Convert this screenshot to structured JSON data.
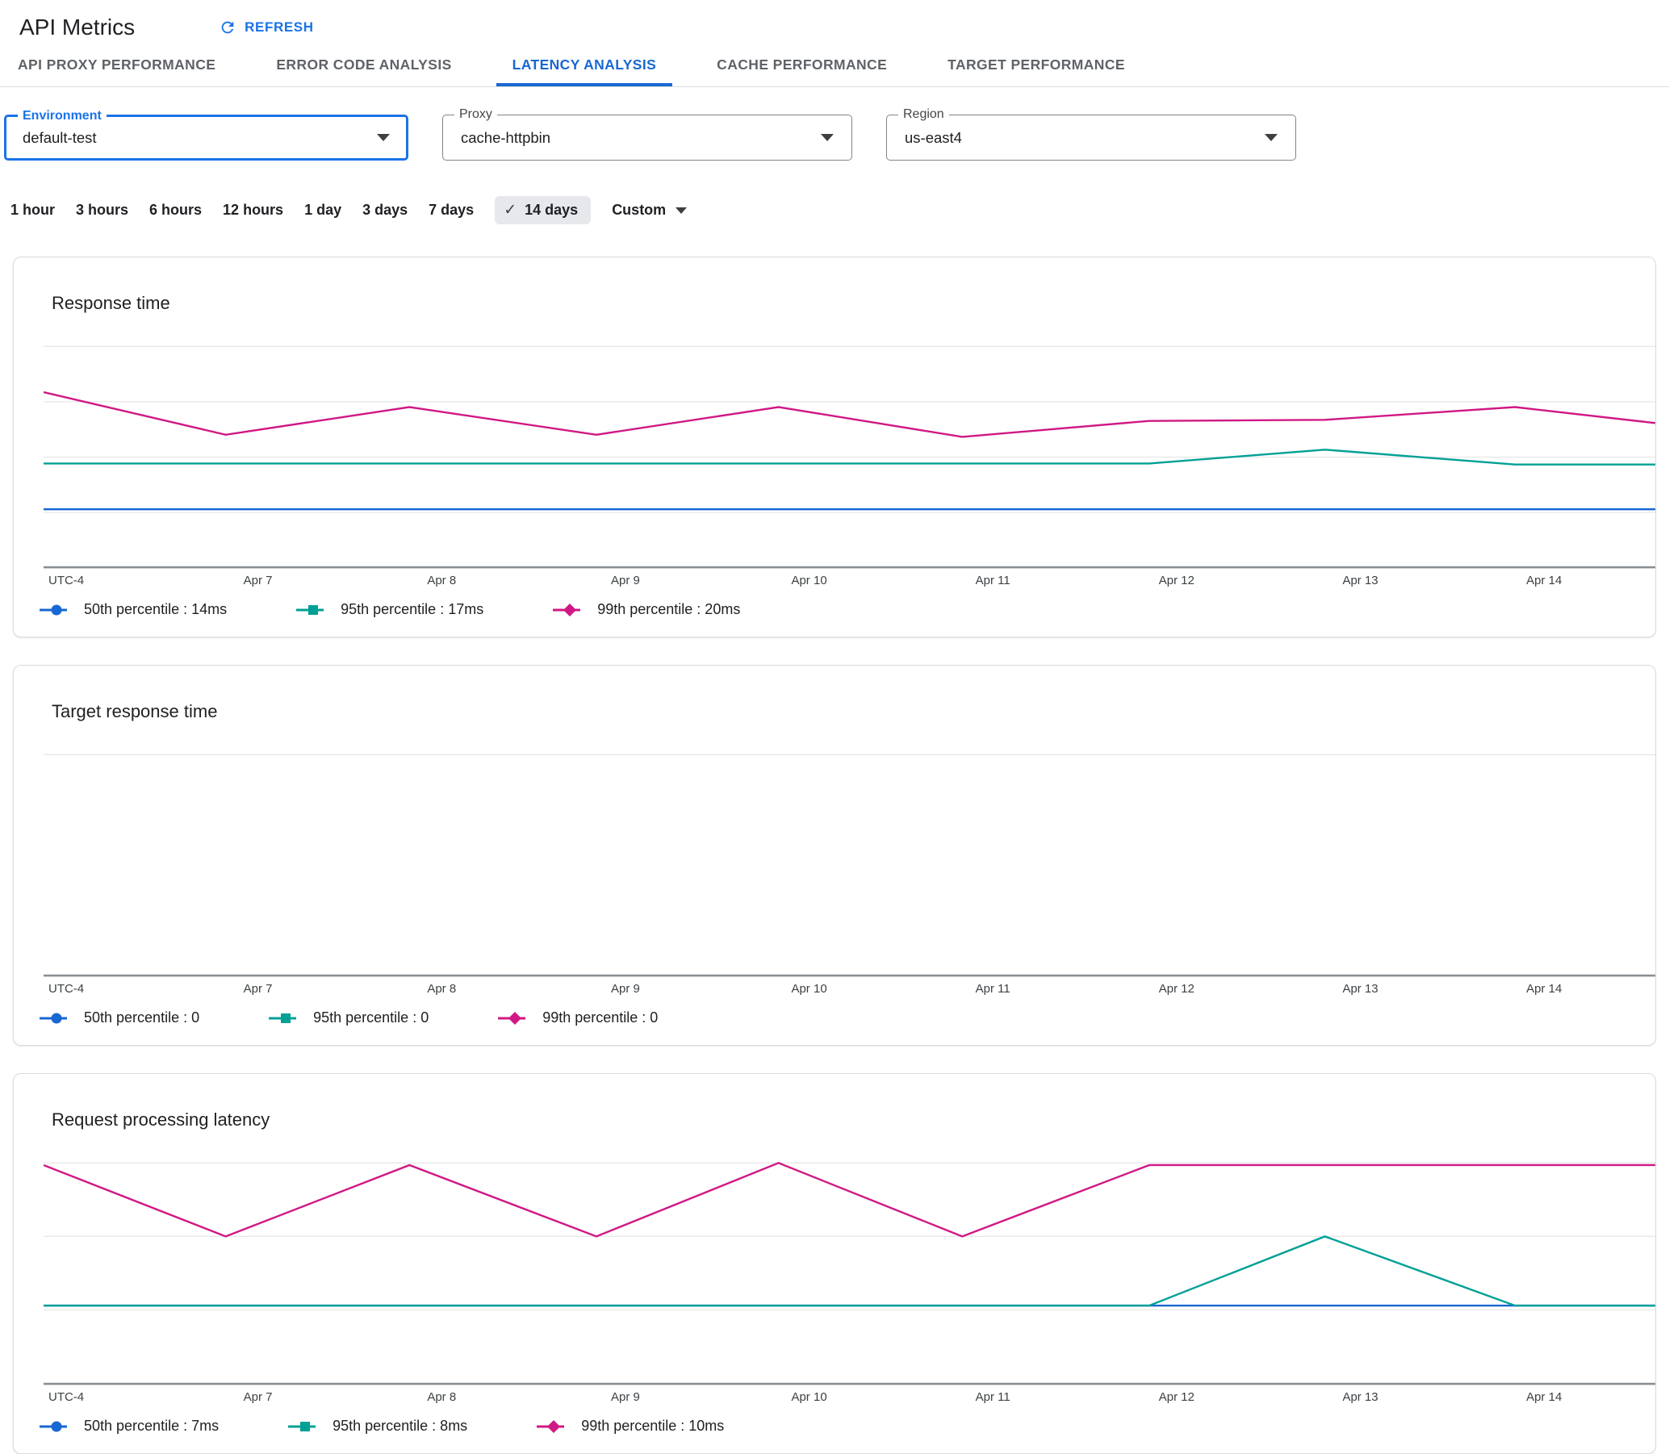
{
  "page": {
    "title": "API Metrics",
    "refresh_label": "REFRESH"
  },
  "icons": {
    "check": "✓"
  },
  "tabs": [
    {
      "label": "API PROXY PERFORMANCE",
      "active": false
    },
    {
      "label": "ERROR CODE ANALYSIS",
      "active": false
    },
    {
      "label": "LATENCY ANALYSIS",
      "active": true
    },
    {
      "label": "CACHE PERFORMANCE",
      "active": false
    },
    {
      "label": "TARGET PERFORMANCE",
      "active": false
    }
  ],
  "filters": [
    {
      "label": "Environment",
      "value": "default-test",
      "focused": true
    },
    {
      "label": "Proxy",
      "value": "cache-httpbin",
      "focused": false
    },
    {
      "label": "Region",
      "value": "us-east4",
      "focused": false
    }
  ],
  "time_ranges": {
    "options": [
      "1 hour",
      "3 hours",
      "6 hours",
      "12 hours",
      "1 day",
      "3 days",
      "7 days",
      "14 days"
    ],
    "selected": "14 days",
    "custom_label": "Custom"
  },
  "colors": {
    "p50": "#1967d2",
    "p95": "#00a096",
    "p99": "#d01884",
    "grid": "#e7e7e7",
    "axis": "#8a8f94",
    "tab_active": "#1967d2",
    "link": "#1a73e8"
  },
  "axis": {
    "utc_label": "UTC-4",
    "ticks": [
      "Apr 7",
      "Apr 8",
      "Apr 9",
      "Apr 10",
      "Apr 11",
      "Apr 12",
      "Apr 13",
      "Apr 14"
    ],
    "tick_pos": [
      13.3,
      24.7,
      36.1,
      47.5,
      58.9,
      70.3,
      81.7,
      93.1
    ]
  },
  "charts": [
    {
      "title": "Response time",
      "type": "line",
      "gridlines": [
        1,
        53,
        105,
        157
      ],
      "series": [
        {
          "name": "50th percentile",
          "color": "p50",
          "marker": "circle",
          "points": [
            [
              0,
              154
            ],
            [
              1000,
              154
            ]
          ]
        },
        {
          "name": "95th percentile",
          "color": "p95",
          "marker": "square",
          "points": [
            [
              0,
              111
            ],
            [
              686,
              111
            ],
            [
              795,
              98
            ],
            [
              913,
              112
            ],
            [
              1000,
              112
            ]
          ]
        },
        {
          "name": "99th percentile",
          "color": "p99",
          "marker": "diamond",
          "points": [
            [
              0,
              44
            ],
            [
              113,
              84
            ],
            [
              227,
              58
            ],
            [
              343,
              84
            ],
            [
              456,
              58
            ],
            [
              570,
              86
            ],
            [
              686,
              71
            ],
            [
              795,
              70
            ],
            [
              913,
              58
            ],
            [
              1000,
              73
            ]
          ]
        }
      ],
      "legend": [
        {
          "label": "50th percentile",
          "value": "14ms",
          "color": "p50",
          "marker": "circle"
        },
        {
          "label": "95th percentile",
          "value": "17ms",
          "color": "p95",
          "marker": "square"
        },
        {
          "label": "99th percentile",
          "value": "20ms",
          "color": "p99",
          "marker": "diamond"
        }
      ]
    },
    {
      "title": "Target response time",
      "type": "line",
      "gridlines": [
        1
      ],
      "series": [],
      "legend": [
        {
          "label": "50th percentile",
          "value": "0",
          "color": "p50",
          "marker": "circle"
        },
        {
          "label": "95th percentile",
          "value": "0",
          "color": "p95",
          "marker": "square"
        },
        {
          "label": "99th percentile",
          "value": "0",
          "color": "p99",
          "marker": "diamond"
        }
      ]
    },
    {
      "title": "Request processing latency",
      "type": "line",
      "gridlines": [
        1,
        70,
        139
      ],
      "series": [
        {
          "name": "50th percentile",
          "color": "p50",
          "marker": "circle",
          "points": [
            [
              0,
              135
            ],
            [
              1000,
              135
            ]
          ]
        },
        {
          "name": "95th percentile",
          "color": "p95",
          "marker": "square",
          "points": [
            [
              0,
              135
            ],
            [
              686,
              135
            ],
            [
              795,
              70
            ],
            [
              913,
              135
            ],
            [
              1000,
              135
            ]
          ]
        },
        {
          "name": "99th percentile",
          "color": "p99",
          "marker": "diamond",
          "points": [
            [
              0,
              3
            ],
            [
              113,
              70
            ],
            [
              227,
              3
            ],
            [
              343,
              70
            ],
            [
              456,
              1
            ],
            [
              570,
              70
            ],
            [
              686,
              3
            ],
            [
              1000,
              3
            ]
          ]
        }
      ],
      "legend": [
        {
          "label": "50th percentile",
          "value": "7ms",
          "color": "p50",
          "marker": "circle"
        },
        {
          "label": "95th percentile",
          "value": "8ms",
          "color": "p95",
          "marker": "square"
        },
        {
          "label": "99th percentile",
          "value": "10ms",
          "color": "p99",
          "marker": "diamond"
        }
      ]
    }
  ]
}
